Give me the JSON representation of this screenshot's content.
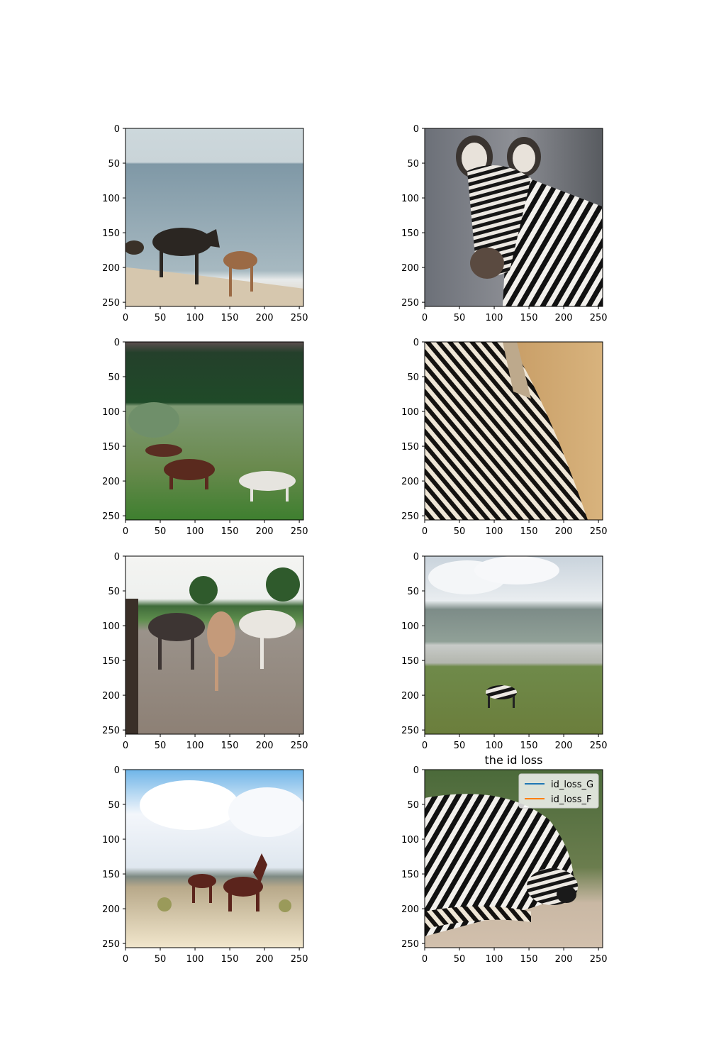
{
  "chart_data": {
    "type": "image-grid",
    "rows": 4,
    "cols": 2,
    "image_size": 256,
    "x_ticks": [
      0,
      50,
      100,
      150,
      200,
      250
    ],
    "y_ticks": [
      0,
      50,
      100,
      150,
      200,
      250
    ],
    "panels": [
      {
        "id": "r0c0",
        "row": 0,
        "col": 0,
        "content": "horses-beach",
        "title": ""
      },
      {
        "id": "r0c1",
        "row": 0,
        "col": 1,
        "content": "zebra-face",
        "title": ""
      },
      {
        "id": "r1c0",
        "row": 1,
        "col": 0,
        "content": "horses-meadow",
        "title": ""
      },
      {
        "id": "r1c1",
        "row": 1,
        "col": 1,
        "content": "zebra-neck-closeup",
        "title": ""
      },
      {
        "id": "r2c0",
        "row": 2,
        "col": 0,
        "content": "horses-paddock",
        "title": ""
      },
      {
        "id": "r2c1",
        "row": 2,
        "col": 1,
        "content": "zebra-grassland",
        "title": ""
      },
      {
        "id": "r3c0",
        "row": 3,
        "col": 0,
        "content": "horses-desert",
        "title": ""
      },
      {
        "id": "r3c1",
        "row": 3,
        "col": 1,
        "content": "zebra-lying",
        "title": "the id loss",
        "legend": {
          "placement": "top-right",
          "entries": [
            {
              "name": "id_loss_G",
              "color": "#1f77b4"
            },
            {
              "name": "id_loss_F",
              "color": "#ff7f0e"
            }
          ]
        }
      }
    ]
  }
}
